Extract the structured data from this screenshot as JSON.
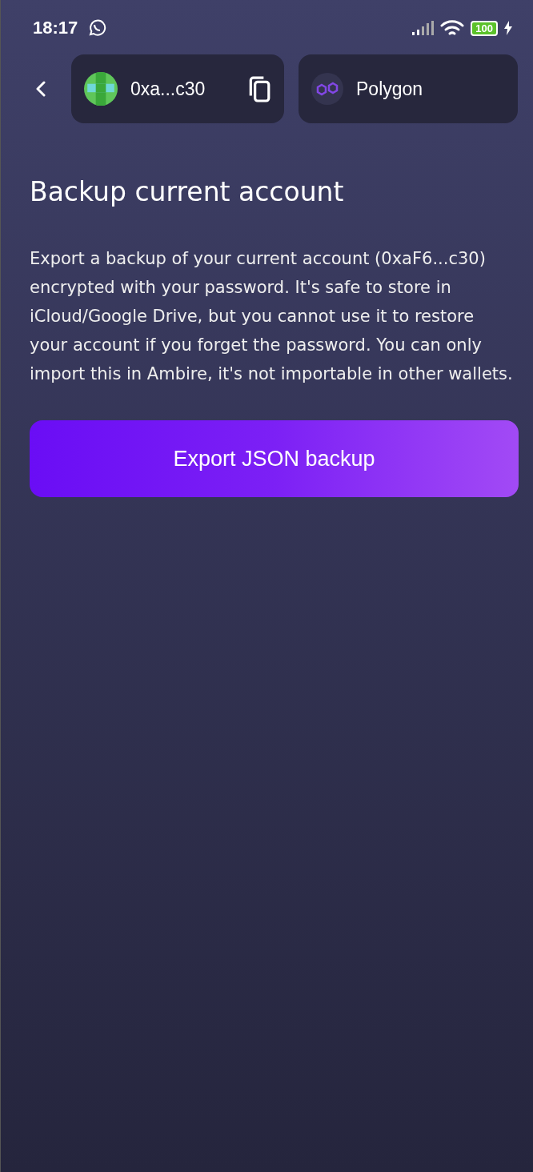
{
  "status_bar": {
    "time": "18:17",
    "battery": "100"
  },
  "header": {
    "account": "0xa...c30",
    "network": "Polygon"
  },
  "title": "Backup current account",
  "description": "Export a backup of your current account (0xaF6...c30) encrypted with your password. It's safe to store in iCloud/Google Drive, but you cannot use it to restore your account if you forget the password. You can only import this in Ambire, it's not importable in other wallets.",
  "button": "Export JSON backup"
}
